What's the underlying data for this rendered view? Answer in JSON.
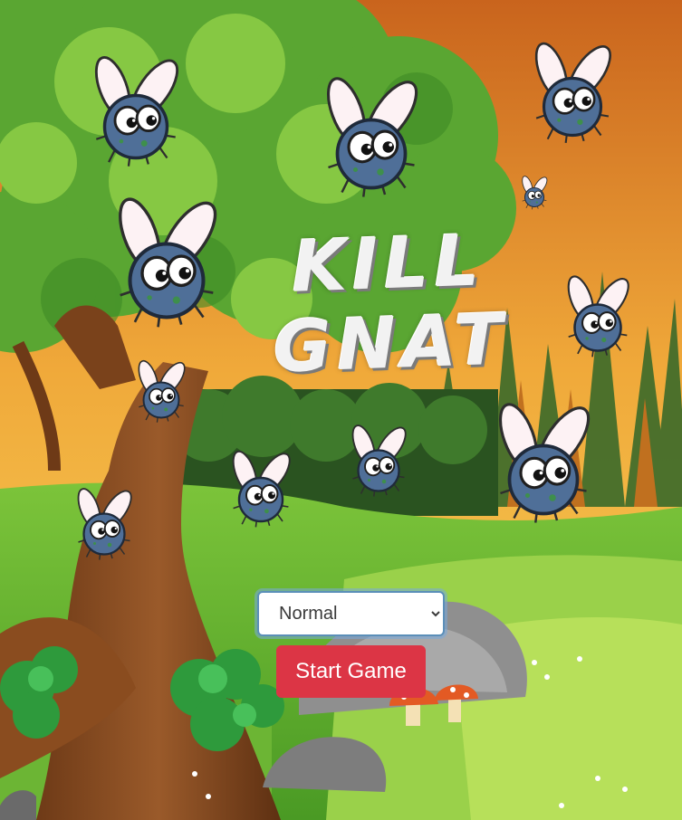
{
  "game": {
    "title_line1": "KILL",
    "title_line2": "GNAT"
  },
  "difficulty": {
    "selected": "Normal"
  },
  "start_button": {
    "label": "Start Game"
  },
  "colors": {
    "start_button": "#dc3545",
    "sky_top": "#d9862a",
    "sky_bottom": "#f6cf4e",
    "grass": "#5cab2d",
    "tree_leaves": "#5aa632",
    "gnat_body": "#4f6f98",
    "gnat_wing": "#fdf2f4"
  },
  "icons": {
    "gnat": "gnat-sprite",
    "select_arrow": "chevron-down-icon"
  }
}
